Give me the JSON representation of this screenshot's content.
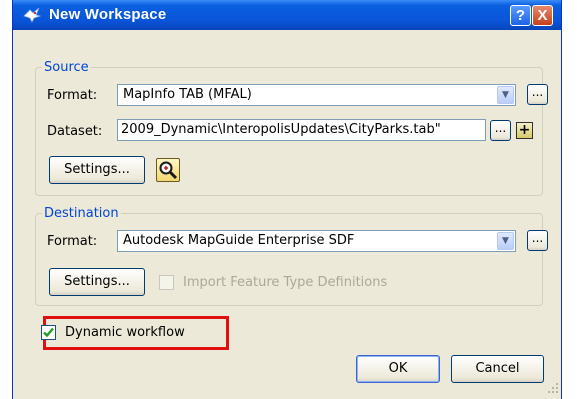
{
  "window": {
    "title": "New Workspace",
    "help_label": "?",
    "close_label": "X"
  },
  "source": {
    "legend": "Source",
    "format_label": "Format:",
    "format_value": "MapInfo TAB (MFAL)",
    "dataset_label": "Dataset:",
    "dataset_value": "2009_Dynamic\\InteropolisUpdates\\CityParks.tab\"",
    "browse_label": "...",
    "add_label": "+",
    "settings_label": "Settings..."
  },
  "destination": {
    "legend": "Destination",
    "format_label": "Format:",
    "format_value": "Autodesk MapGuide Enterprise SDF",
    "browse_label": "...",
    "settings_label": "Settings...",
    "import_ft_label": "Import Feature Type Definitions",
    "import_ft_checked": false
  },
  "dynamic_workflow": {
    "label": "Dynamic workflow",
    "checked": true
  },
  "buttons": {
    "ok": "OK",
    "cancel": "Cancel"
  },
  "colors": {
    "title_bar": "#0a54d8",
    "legend_text": "#0046d5",
    "highlight_border": "#e01010",
    "check_mark": "#21a121"
  }
}
